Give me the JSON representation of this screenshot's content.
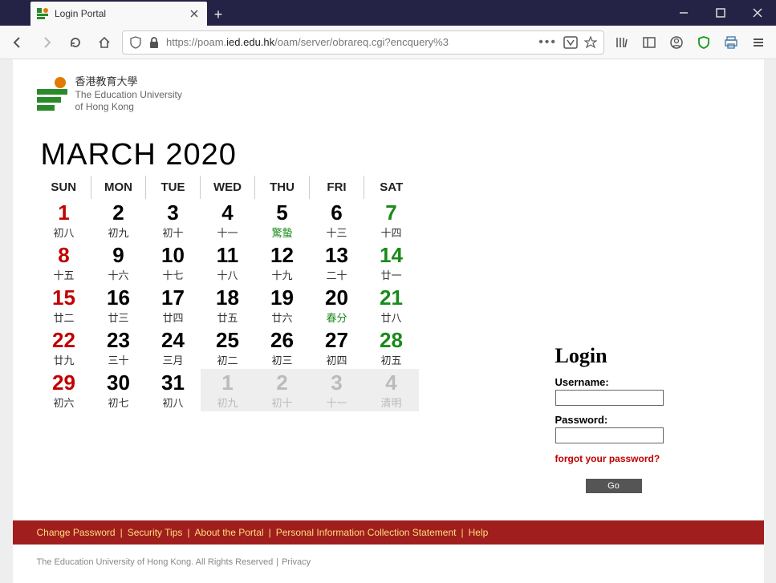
{
  "browser": {
    "tab_title": "Login Portal",
    "url_prefix": "https://poam.",
    "url_host": "ied.edu.hk",
    "url_path": "/oam/server/obrareq.cgi?encquery%3"
  },
  "logo": {
    "cn": "香港教育大學",
    "en1": "The Education University",
    "en2": "of Hong Kong"
  },
  "calendar": {
    "title": "MARCH 2020",
    "dow": [
      "SUN",
      "MON",
      "TUE",
      "WED",
      "THU",
      "FRI",
      "SAT"
    ],
    "weeks": [
      [
        {
          "n": "1",
          "l": "初八",
          "c": "red"
        },
        {
          "n": "2",
          "l": "初九",
          "c": ""
        },
        {
          "n": "3",
          "l": "初十",
          "c": ""
        },
        {
          "n": "4",
          "l": "十一",
          "c": ""
        },
        {
          "n": "5",
          "l": "驚蟄",
          "c": "grn-l"
        },
        {
          "n": "6",
          "l": "十三",
          "c": ""
        },
        {
          "n": "7",
          "l": "十四",
          "c": "grn"
        }
      ],
      [
        {
          "n": "8",
          "l": "十五",
          "c": "red"
        },
        {
          "n": "9",
          "l": "十六",
          "c": ""
        },
        {
          "n": "10",
          "l": "十七",
          "c": ""
        },
        {
          "n": "11",
          "l": "十八",
          "c": ""
        },
        {
          "n": "12",
          "l": "十九",
          "c": ""
        },
        {
          "n": "13",
          "l": "二十",
          "c": ""
        },
        {
          "n": "14",
          "l": "廿一",
          "c": "grn"
        }
      ],
      [
        {
          "n": "15",
          "l": "廿二",
          "c": "red"
        },
        {
          "n": "16",
          "l": "廿三",
          "c": ""
        },
        {
          "n": "17",
          "l": "廿四",
          "c": ""
        },
        {
          "n": "18",
          "l": "廿五",
          "c": ""
        },
        {
          "n": "19",
          "l": "廿六",
          "c": ""
        },
        {
          "n": "20",
          "l": "春分",
          "c": "grn-l"
        },
        {
          "n": "21",
          "l": "廿八",
          "c": "grn"
        }
      ],
      [
        {
          "n": "22",
          "l": "廿九",
          "c": "red"
        },
        {
          "n": "23",
          "l": "三十",
          "c": ""
        },
        {
          "n": "24",
          "l": "三月",
          "c": ""
        },
        {
          "n": "25",
          "l": "初二",
          "c": ""
        },
        {
          "n": "26",
          "l": "初三",
          "c": ""
        },
        {
          "n": "27",
          "l": "初四",
          "c": ""
        },
        {
          "n": "28",
          "l": "初五",
          "c": "grn"
        }
      ],
      [
        {
          "n": "29",
          "l": "初六",
          "c": "red"
        },
        {
          "n": "30",
          "l": "初七",
          "c": ""
        },
        {
          "n": "31",
          "l": "初八",
          "c": ""
        },
        {
          "n": "1",
          "l": "初九",
          "c": "dim"
        },
        {
          "n": "2",
          "l": "初十",
          "c": "dim"
        },
        {
          "n": "3",
          "l": "十一",
          "c": "dim"
        },
        {
          "n": "4",
          "l": "清明",
          "c": "dim"
        }
      ]
    ]
  },
  "login": {
    "heading": "Login",
    "username_label": "Username:",
    "password_label": "Password:",
    "forgot": "forgot your password?",
    "go": "Go"
  },
  "footer": {
    "links": [
      "Change Password",
      "Security Tips",
      "About the Portal",
      "Personal Information Collection Statement",
      "Help"
    ],
    "copyright": "The Education University of Hong Kong. All Rights Reserved",
    "privacy": "Privacy"
  }
}
